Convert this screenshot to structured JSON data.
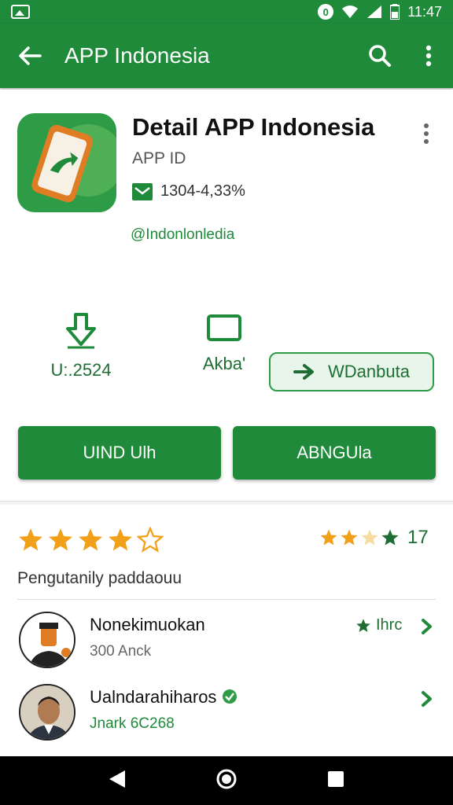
{
  "status_bar": {
    "badge": "0",
    "time": "11:47"
  },
  "app_bar": {
    "title": "APP Indonesia"
  },
  "app": {
    "name": "Detail APP Indonesia",
    "id": "APP ID",
    "stat": "1304-4,33%",
    "developer": "@Indonlonledia"
  },
  "actions": [
    {
      "label": "U:.2524",
      "icon": "download-icon"
    },
    {
      "label": "Akba'",
      "icon": "tablet-icon"
    }
  ],
  "share_label": "WDanbuta",
  "buttons": {
    "primary": "UIND  Ulh",
    "secondary": "ABNGUla"
  },
  "rating": {
    "filled_stars": 4,
    "total_stars": 5,
    "small_stars_filled": 2,
    "count": "17",
    "subtitle": "Pengutanily paddaouu"
  },
  "reviews": [
    {
      "name": "Nonekimuokan",
      "sub": "300 Anck",
      "rating_text": "Ihrc"
    },
    {
      "name": "Ualndarahiharos",
      "sub": "Jnark  6C268"
    }
  ],
  "colors": {
    "primary": "#1e8a3a",
    "star": "#f2a01a"
  }
}
